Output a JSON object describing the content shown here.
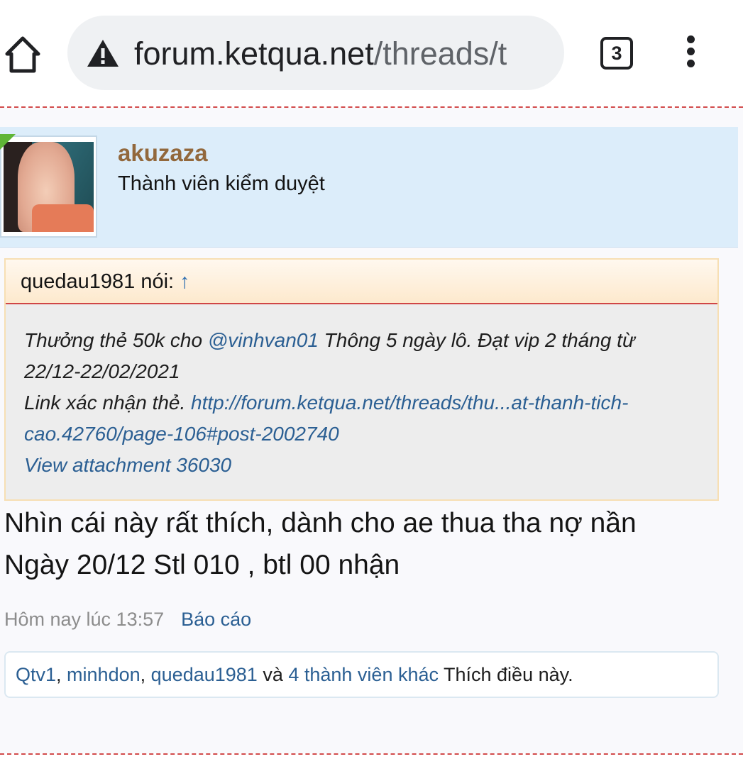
{
  "browser": {
    "url_domain": "forum.ketqua.net",
    "url_path": "/threads/t",
    "tab_count": "3",
    "icons": {
      "home": "home-icon",
      "security": "warning-triangle-icon",
      "tabs": "tab-switcher-icon",
      "menu": "more-vert-icon"
    }
  },
  "post": {
    "author": {
      "username": "akuzaza",
      "title": "Thành viên kiểm duyệt",
      "username_color": "#92683c"
    },
    "quote": {
      "attribution": "quedau1981 nói:",
      "arrow": "↑",
      "line1_prefix": "Thưởng thẻ 50k cho ",
      "mention": "@vinhvan01",
      "line1_suffix": " Thông 5 ngày lô. Đạt vip 2 tháng từ",
      "line2": "22/12-22/02/2021",
      "link_label": "Link xác nhận thẻ. ",
      "link_url_part1": "http://forum.ketqua.net/threads/thu...at-thanh-tich-",
      "link_url_part2": "cao.42760/page-106#post-2002740",
      "attachment": "View attachment 36030"
    },
    "message": {
      "line1": "Nhìn cái này rất thích, dành cho ae thua tha nợ nần",
      "line2": "Ngày 20/12 Stl 010 , btl 00 nhận"
    },
    "meta": {
      "time": "Hôm nay lúc 13:57",
      "report": "Báo cáo"
    },
    "likes": {
      "user1": "Qtv1",
      "sep1": ", ",
      "user2": "minhdon",
      "sep2": ", ",
      "user3": "quedau1981",
      "and": " và ",
      "others": "4 thành viên khác",
      "suffix": " Thích điều này."
    }
  },
  "colors": {
    "link": "#2b5f93",
    "user_block_bg": "#dcedfa",
    "quote_bg": "#ededed",
    "divider": "#d24b4b"
  }
}
